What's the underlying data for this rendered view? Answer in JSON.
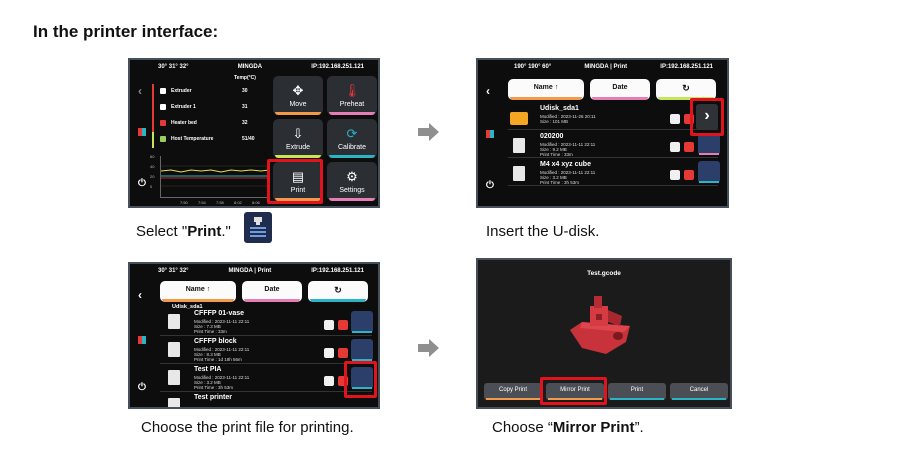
{
  "heading": "In the printer interface:",
  "captions": {
    "step1_pre": "Select \"",
    "step1_bold": "Print",
    "step1_post": ".\"",
    "step2": "Insert the U-disk.",
    "step3": "Choose the print file for printing.",
    "step4_pre": "Choose “",
    "step4_bold": "Mirror Print",
    "step4_post": "”."
  },
  "screen1": {
    "temps": "30°  31°  32°",
    "brand": "MINGDA",
    "ip": "IP:192.168.251.121",
    "temp_header": "Temp(°C)",
    "rows": [
      {
        "label": "Extruder",
        "value": "30",
        "color": "#ffffff"
      },
      {
        "label": "Extruder 1",
        "value": "31",
        "color": "#ffffff"
      },
      {
        "label": "Heater bed",
        "value": "32",
        "color": "#e53935"
      },
      {
        "label": "Host Temperature",
        "value": "51/40",
        "color": "#9ccc65"
      }
    ],
    "chart_yticks": [
      "60",
      "40",
      "20",
      "0"
    ],
    "chart_xticks": [
      "7:50",
      "7:54",
      "7:58",
      "8:02",
      "8:06"
    ],
    "tiles": [
      {
        "label": "Move",
        "color": "#f2994a"
      },
      {
        "label": "Preheat",
        "color": "#e57eb4"
      },
      {
        "label": "Extrude",
        "color": "#c7e55a"
      },
      {
        "label": "Calibrate",
        "color": "#2bb3c6"
      },
      {
        "label": "Print",
        "color": "#f2994a"
      },
      {
        "label": "Settings",
        "color": "#e57eb4"
      }
    ]
  },
  "screen2": {
    "temps": "190° 190°  60°",
    "brand": "MINGDA | Print",
    "ip": "IP:192.168.251.121",
    "name_btn": "Name",
    "date_btn": "Date",
    "files": [
      {
        "name": "Udisk_sda1",
        "m1": "Modified : 2023-11-26 20:11",
        "m2": "Size : 101 MB",
        "m3": ""
      },
      {
        "name": "020200",
        "m1": "Modified : 2023-11-11 22:11",
        "m2": "Size : 9.2 MB",
        "m3": "Print Time : 33m"
      },
      {
        "name": "M4 x4 xyz cube",
        "m1": "Modified : 2023-11-11 22:11",
        "m2": "Size : 3.2 MB",
        "m3": "Print Time : 3h 53m"
      }
    ]
  },
  "screen3": {
    "temps": "30°  31°  32°",
    "brand": "MINGDA | Print",
    "ip": "IP:192.168.251.121",
    "name_btn": "Name",
    "date_btn": "Date",
    "folder": "Udisk_sda1",
    "files": [
      {
        "name": "CFFFP 01-vase",
        "m1": "Modified : 2023-11-11 22:11",
        "m2": "Size : 7.3 MB",
        "m3": "Print Time : 33m"
      },
      {
        "name": "CFFFP block",
        "m1": "Modified : 2023-11-11 22:11",
        "m2": "Size : 8.3 MB",
        "m3": "Print Time : 1d 18h 56m"
      },
      {
        "name": "Test PIA",
        "m1": "Modified : 2023-11-11 22:11",
        "m2": "Size : 3.2 MB",
        "m3": "Print Time : 3h 53m"
      },
      {
        "name": "Test printer",
        "m1": "",
        "m2": "",
        "m3": ""
      }
    ]
  },
  "screen4": {
    "title": "Test.gcode",
    "buttons": [
      {
        "label": "Copy Print",
        "color": "#f2994a"
      },
      {
        "label": "Mirror Print",
        "color": "#f2994a"
      },
      {
        "label": "Print",
        "color": "#2bb3c6"
      },
      {
        "label": "Cancel",
        "color": "#2bb3c6"
      }
    ]
  }
}
